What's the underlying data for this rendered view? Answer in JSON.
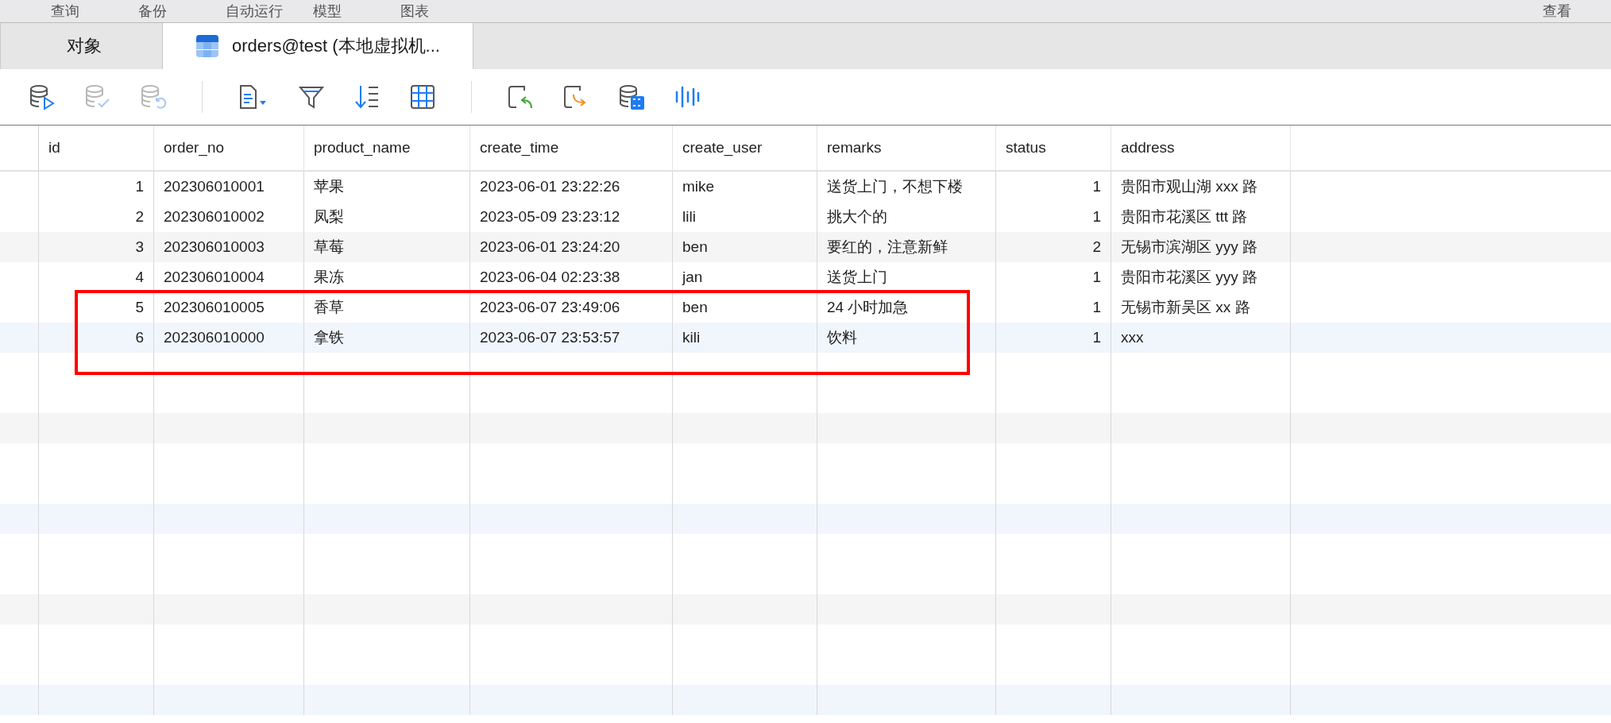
{
  "menu": [
    "查询",
    "备份",
    "自动运行",
    "模型",
    "图表",
    "查看"
  ],
  "tabs": [
    {
      "label": "对象",
      "selected": false,
      "kind": "plain"
    },
    {
      "label": "orders@test (本地虚拟机...",
      "selected": true,
      "kind": "table"
    }
  ],
  "toolbar": [
    {
      "kind": "db-run",
      "disabled": false
    },
    {
      "kind": "db-check",
      "disabled": true
    },
    {
      "kind": "db-undo",
      "disabled": true
    },
    {
      "kind": "sep"
    },
    {
      "kind": "doc",
      "disabled": false
    },
    {
      "kind": "filter",
      "disabled": false
    },
    {
      "kind": "sort",
      "disabled": false
    },
    {
      "kind": "grid",
      "disabled": false
    },
    {
      "kind": "sep"
    },
    {
      "kind": "import",
      "disabled": false
    },
    {
      "kind": "export",
      "disabled": false
    },
    {
      "kind": "db-binary",
      "disabled": false
    },
    {
      "kind": "wave",
      "disabled": false
    }
  ],
  "table": {
    "columns": [
      {
        "name": "id",
        "kind": "number"
      },
      {
        "name": "order_no",
        "kind": "text"
      },
      {
        "name": "product_name",
        "kind": "text"
      },
      {
        "name": "create_time",
        "kind": "text"
      },
      {
        "name": "create_user",
        "kind": "text"
      },
      {
        "name": "remarks",
        "kind": "text"
      },
      {
        "name": "status",
        "kind": "number"
      },
      {
        "name": "address",
        "kind": "text"
      }
    ],
    "rows": [
      {
        "cells": [
          "1",
          "202306010001",
          "苹果",
          "2023-06-01 23:22:26",
          "mike",
          "送货上门，不想下楼",
          "1",
          "贵阳市观山湖 xxx 路"
        ]
      },
      {
        "cells": [
          "2",
          "202306010002",
          "凤梨",
          "2023-05-09 23:23:12",
          "lili",
          "挑大个的",
          "1",
          "贵阳市花溪区 ttt 路"
        ]
      },
      {
        "cells": [
          "3",
          "202306010003",
          "草莓",
          "2023-06-01 23:24:20",
          "ben",
          "要红的，注意新鲜",
          "2",
          "无锡市滨湖区 yyy 路"
        ]
      },
      {
        "cells": [
          "4",
          "202306010004",
          "果冻",
          "2023-06-04 02:23:38",
          "jan",
          "送货上门",
          "1",
          "贵阳市花溪区 yyy 路"
        ]
      },
      {
        "cells": [
          "5",
          "202306010005",
          "香草",
          "2023-06-07 23:49:06",
          "ben",
          "24 小时加急",
          "1",
          "无锡市新吴区 xx 路"
        ]
      },
      {
        "cells": [
          "6",
          "202306010000",
          "拿铁",
          "2023-06-07 23:53:57",
          "kili",
          "饮料",
          "1",
          "xxx"
        ]
      }
    ]
  },
  "annotation": {
    "kind": "rectangle",
    "color": "#ff0000"
  }
}
